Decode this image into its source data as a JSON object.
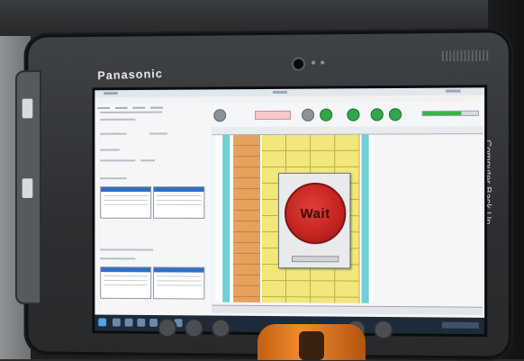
{
  "device": {
    "brand": "Panasonic",
    "model": "",
    "side_label": "Computer Back Up"
  },
  "screen": {
    "dialog": {
      "text": "Wait"
    }
  },
  "colors": {
    "accent_green": "#2fa84a",
    "wait_red": "#c22320",
    "grid_yellow": "#f1e77a",
    "grid_orange": "#e8a05d",
    "grid_cyan": "#6fd0d6"
  },
  "icons": [
    "camera-icon",
    "start-icon",
    "taskbar-app-icon",
    "status-light-icon"
  ]
}
